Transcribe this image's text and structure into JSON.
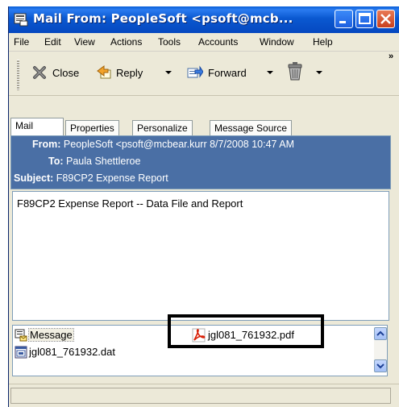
{
  "window": {
    "title": "Mail From: PeopleSoft <psoft@mcb...",
    "controls": {
      "minimize_icon": "minimize-icon",
      "maximize_icon": "maximize-icon",
      "close_icon": "close-icon"
    }
  },
  "menu": {
    "items": [
      "File",
      "Edit",
      "View",
      "Actions",
      "Tools",
      "Accounts",
      "Window",
      "Help"
    ]
  },
  "toolbar": {
    "close_label": "Close",
    "reply_label": "Reply",
    "forward_label": "Forward",
    "more_label": "»"
  },
  "tabs": [
    "Mail",
    "Properties",
    "Personalize",
    "Message Source"
  ],
  "header": {
    "from_label": "From:",
    "from_value": "PeopleSoft <psoft@mcbear.kurr 8/7/2008 10:47 AM",
    "to_label": "To:",
    "to_value": "Paula Shettleroe",
    "subject_label": "Subject:",
    "subject_value": "F89CP2  Expense Report"
  },
  "body": {
    "text": "F89CP2  Expense Report -- Data File and Report"
  },
  "attachments": [
    {
      "name": "Message",
      "icon": "message-icon"
    },
    {
      "name": "jgl081_761932.dat",
      "icon": "dat-file-icon"
    },
    {
      "name": "jgl081_761932.pdf",
      "icon": "pdf-icon"
    }
  ],
  "colors": {
    "titlebar": "#0a58d0",
    "header_bg": "#4a6fa5",
    "chrome": "#ece9d8"
  }
}
